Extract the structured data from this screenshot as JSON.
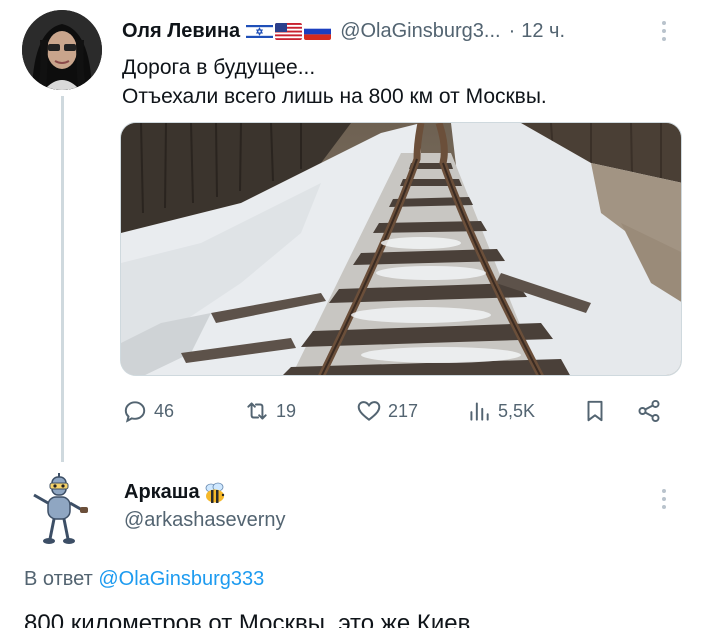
{
  "tweet1": {
    "author_name": "Оля Левина",
    "flags": [
      "israel-flag",
      "usa-flag",
      "russia-flag"
    ],
    "handle": "@OlaGinsburg3...",
    "dot": "·",
    "time": "12 ч.",
    "text_line1": "Дорога в будущее...",
    "text_line2": "Отъехали всего лишь на 800 км от Москвы.",
    "actions": {
      "replies": "46",
      "reposts": "19",
      "likes": "217",
      "views": "5,5K"
    }
  },
  "tweet2": {
    "author_name": "Аркаша",
    "handle": "@arkashaseverny",
    "reply_prefix": "В ответ",
    "reply_handle": "@OlaGinsburg333",
    "text_partial": "800 километров от Москвы, это же Киев"
  },
  "colors": {
    "muted": "#536471",
    "link": "#1d9bf0",
    "thread_line": "#cfd9de"
  }
}
